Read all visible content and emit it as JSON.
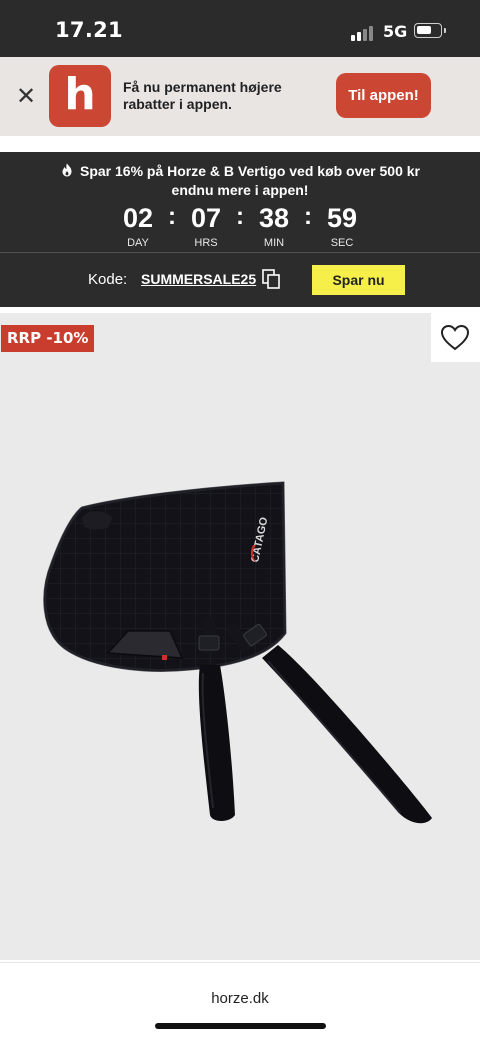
{
  "status_bar": {
    "time": "17.21",
    "network": "5G",
    "icons": [
      "signal-icon",
      "battery-icon"
    ]
  },
  "app_banner": {
    "close_icon": "close-icon",
    "logo_letter": "h",
    "message": "Få nu permanent højere rabatter i appen.",
    "button_label": "Til appen!",
    "accent_color": "#cc4634"
  },
  "promo": {
    "headline": "Spar 16% på Horze & B Vertigo ved køb over 500 kr endnu mere i appen!",
    "icon": "flame-icon",
    "countdown": [
      {
        "value": "02",
        "label": "DAY"
      },
      {
        "value": "07",
        "label": "HRS"
      },
      {
        "value": "38",
        "label": "MIN"
      },
      {
        "value": "59",
        "label": "SEC"
      }
    ],
    "code_label": "Kode:",
    "code_value": "SUMMERSALE25",
    "copy_icon": "copy-icon",
    "button_label": "Spar nu",
    "button_color": "#f6ef4a"
  },
  "product": {
    "badge": "RRP -10%",
    "badge_color": "#c93d2e",
    "wishlist_icon": "heart-icon",
    "image_logo_text": "CATAGO"
  },
  "browser": {
    "url": "horze.dk"
  }
}
